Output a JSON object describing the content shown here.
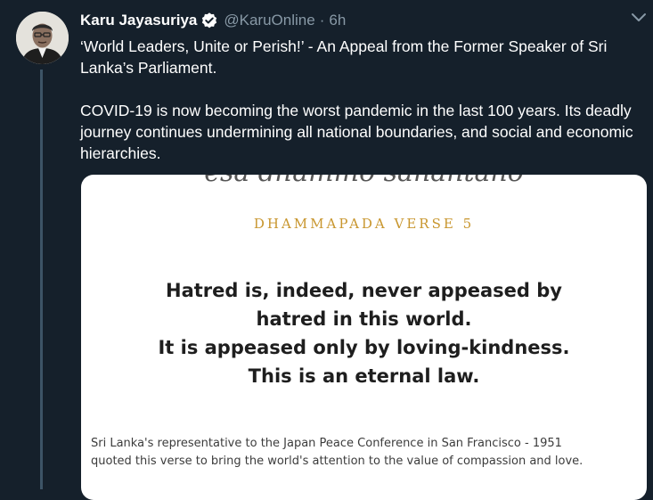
{
  "tweet": {
    "author_name": "Karu Jayasuriya",
    "handle": "@KaruOnline",
    "separator": "·",
    "time": "6h",
    "paragraphs": [
      "‘World Leaders, Unite or Perish!’ - An Appeal from the Former Speaker of Sri Lanka’s Parliament.",
      "COVID-19 is now becoming the worst pandemic in the last 100 years. Its deadly journey continues undermining all national boundaries, and social and economic hierarchies."
    ]
  },
  "card": {
    "pali_fragment": "esa dhammo sanantano",
    "verse_title": "DHAMMAPADA VERSE 5",
    "quote_lines": [
      "Hatred is, indeed, never appeased by",
      "hatred in this world.",
      "It is appeased only by loving-kindness.",
      "This is an eternal law."
    ],
    "caption_lines": [
      "Sri Lanka's representative to the Japan Peace Conference in San Francisco - 1951",
      "quoted this verse to bring the world's attention to the value of compassion and love."
    ]
  },
  "icons": {
    "verified": "verified-badge-icon",
    "menu": "chevron-down-icon"
  },
  "colors": {
    "background": "#15202b",
    "secondary_text": "#8899a6",
    "verse_title": "#c8962e"
  }
}
